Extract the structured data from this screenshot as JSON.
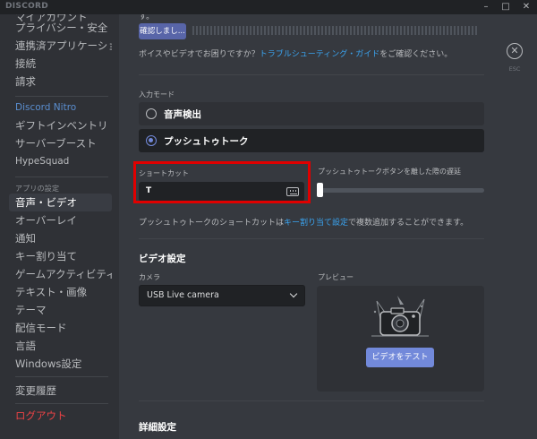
{
  "app": {
    "brand": "DISCORD"
  },
  "window_controls": {
    "minimize": "–",
    "maximize": "□",
    "close": "✕"
  },
  "sidebar": {
    "top_partial": "マイアカウント",
    "items_user": [
      {
        "label": "プライバシー・安全"
      },
      {
        "label": "連携済アプリケーショ..."
      },
      {
        "label": "接続"
      },
      {
        "label": "請求"
      }
    ],
    "nitro_header": "Discord Nitro",
    "items_nitro": [
      {
        "label": "ギフトインベントリ"
      },
      {
        "label": "サーバーブースト"
      }
    ],
    "hypesquad": "HypeSquad",
    "app_settings_header": "アプリの設定",
    "items_app": [
      {
        "label": "音声・ビデオ",
        "selected": true
      },
      {
        "label": "オーバーレイ"
      },
      {
        "label": "通知"
      },
      {
        "label": "キー割り当て"
      },
      {
        "label": "ゲームアクティビティ"
      },
      {
        "label": "テキスト・画像"
      },
      {
        "label": "テーマ"
      },
      {
        "label": "配信モード"
      },
      {
        "label": "言語"
      },
      {
        "label": "Windows設定"
      }
    ],
    "changelog": "変更履歴",
    "logout": "ログアウト"
  },
  "main": {
    "top_partial_text": "す。",
    "mic_test_button": "確認しまし...",
    "help_text_before": "ボイスやビデオでお困りですか？",
    "help_link": "トラブルシューティング・ガイド",
    "help_text_after": "をご確認ください。",
    "close_label": "ESC",
    "input_mode": {
      "label": "入力モード",
      "options": [
        {
          "label": "音声検出",
          "selected": false
        },
        {
          "label": "プッシュトゥトーク",
          "selected": true
        }
      ]
    },
    "shortcut": {
      "label": "ショートカット",
      "value": "T"
    },
    "release_delay": {
      "label": "プッシュトゥトークボタンを離した際の遅延",
      "value_fraction": 0
    },
    "ptt_note_before": "プッシュトゥトークのショートカットは",
    "ptt_note_link": "キー割り当て設定",
    "ptt_note_after": "で複数追加することができます。",
    "video": {
      "title": "ビデオ設定",
      "camera_label": "カメラ",
      "camera_value": "USB Live camera",
      "preview_label": "プレビュー",
      "test_button": "ビデオをテスト"
    },
    "advanced_title": "詳細設定"
  },
  "colors": {
    "accent": "#7289da",
    "link": "#3aa4f0",
    "danger": "#ed4245",
    "highlight_box": "#e00000"
  }
}
